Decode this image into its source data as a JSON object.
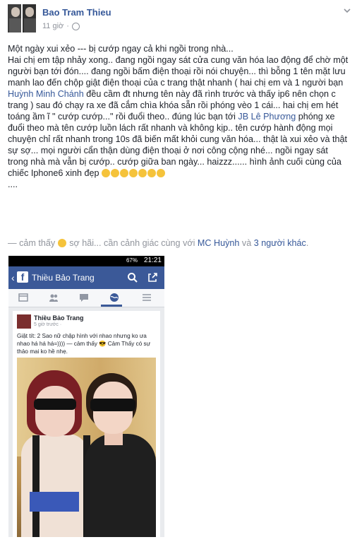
{
  "post": {
    "author": "Bao Tram Thieu",
    "time": "11 giờ",
    "paragraph_lines": [
      "Một ngày xui xẻo --- bị cướp ngay cả khi ngồi trong nhà...",
      "Hai chị em tập nhảy xong.. đang ngồi ngay sát cửa cung văn hóa lao động để chờ một người bạn tới đón.... đang ngồi bấm điện thoại rồi nói chuyện... thì bỗng 1 tên mặt lưu manh lao đến chộp giật điện thoại của c trang thật nhanh ( hai chị em và 1 người bạn ",
      "Huỳnh Minh Chánh",
      " đều cầm đt nhưng tên này đã rình trước và thấy ip6 nên chọn c trang ) sau đó chạy ra xe đã cắm chìa khóa sẵn rồi phóng vèo 1 cái... hai chị em hét toáng ầm ĩ \" cướp cướp...\" rồi đuổi theo.. đúng lúc bạn tới ",
      "JB Lê Phương",
      " phóng xe đuổi theo mà tên cướp luồn lách rất nhanh và không kịp.. tên cướp hành động mọi chuyện chỉ rất nhanh trong 10s đã biến mất khỏi cung văn hóa... thật là xui xẻo và thật sự sợ... mọi người cẩn thận dùng điện thoại ở nơi công cộng nhé... ngồi ngay sát trong nhà mà vẫn bị cướp.. cướp giữa ban ngày... haizzz...... hình ảnh cuối cùng của chiếc Iphone6 xinh đẹp ",
      "...."
    ],
    "feeling_prefix": "— cảm thấy",
    "feeling_text": "sợ hãi... cần cảnh giác cùng với",
    "tag_person": "MC Huỳnh",
    "and_text": "và",
    "others": "3 người khác",
    "period": "."
  },
  "screenshot": {
    "status_battery": "67%",
    "status_time": "21:21",
    "page_name": "Thiều Bảo Trang",
    "card_name": "Thiều Bảo Trang",
    "card_time": "5 giờ trước · ",
    "card_text": "Giật tít: 2 Sao nữ chập hình với nhao nhưng ko ưa nhao há há há=)))) — cảm thấy 😎 Cảm Thấy có sự thảo mai ko hề nhẹ."
  },
  "colors": {
    "link": "#365899",
    "fb_blue": "#3b5998",
    "meta_gray": "#90949c"
  },
  "icons": [
    "chevron-down-icon",
    "globe-icon",
    "sad-emoji-icon",
    "laugh-emoji-icon",
    "cry-emoji-icon",
    "search-icon",
    "share-icon"
  ]
}
